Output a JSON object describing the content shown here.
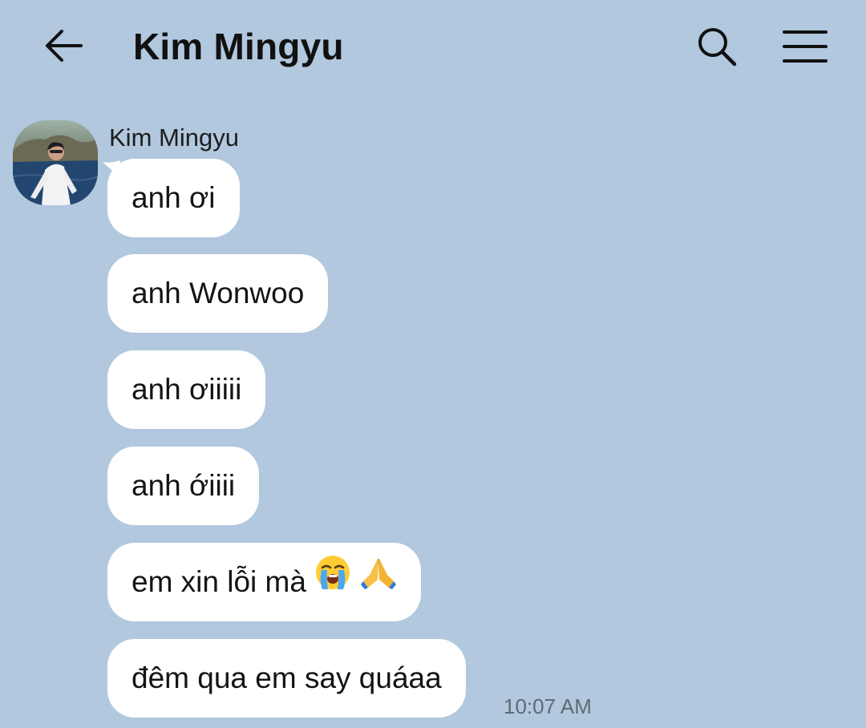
{
  "header": {
    "title": "Kim Mingyu",
    "back_icon": "arrow-left-icon",
    "search_icon": "search-icon",
    "menu_icon": "hamburger-menu-icon"
  },
  "conversation": {
    "sender_name": "Kim Mingyu",
    "avatar_icon": "contact-avatar-photo",
    "messages": [
      {
        "text": "anh ơi"
      },
      {
        "text": "anh Wonwoo"
      },
      {
        "text": "anh ơiiiii"
      },
      {
        "text": "anh ớiiii"
      },
      {
        "text": "em xin lỗi mà",
        "emojis": [
          "loudly-crying-face",
          "folded-hands"
        ]
      },
      {
        "text": "đêm qua em say quáaa"
      }
    ],
    "last_timestamp": "10:07 AM"
  },
  "colors": {
    "background": "#b1c8de",
    "bubble": "#ffffff",
    "text": "#111111",
    "timestamp": "#5f6a73"
  }
}
